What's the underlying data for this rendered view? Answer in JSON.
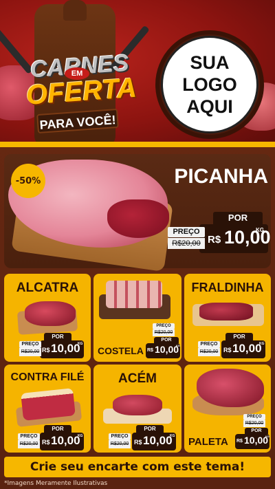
{
  "header": {
    "title_line1": "CARNES",
    "title_em": "EM",
    "title_line2": "OFERTA",
    "title_line3": "PARA VOCÊ!",
    "logo_lines": [
      "SUA",
      "LOGO",
      "AQUI"
    ]
  },
  "hero": {
    "badge": "-50%",
    "name": "PICANHA",
    "preco_label": "PREÇO",
    "old_price": "R$20,00",
    "por_label": "POR",
    "currency": "R$",
    "new_price": "10,00",
    "unit": "KG"
  },
  "products": [
    {
      "name": "ALCATRA",
      "preco_label": "PREÇO",
      "old_price": "R$20,00",
      "por_label": "POR",
      "currency": "R$",
      "new_price": "10,00",
      "unit": "KG"
    },
    {
      "name": "COSTELA",
      "preco_label": "PREÇO",
      "old_price": "R$20,00",
      "por_label": "POR",
      "currency": "R$",
      "new_price": "10,00",
      "unit": "KG"
    },
    {
      "name": "FRALDINHA",
      "preco_label": "PREÇO",
      "old_price": "R$20,00",
      "por_label": "POR",
      "currency": "R$",
      "new_price": "10,00",
      "unit": "KG"
    },
    {
      "name": "CONTRA FILÉ",
      "preco_label": "PREÇO",
      "old_price": "R$20,00",
      "por_label": "POR",
      "currency": "R$",
      "new_price": "10,00",
      "unit": "KG"
    },
    {
      "name": "ACÉM",
      "preco_label": "PREÇO",
      "old_price": "R$20,00",
      "por_label": "POR",
      "currency": "R$",
      "new_price": "10,00",
      "unit": "KG"
    },
    {
      "name": "PALETA",
      "preco_label": "PREÇO",
      "old_price": "R$20,00",
      "por_label": "POR",
      "currency": "R$",
      "new_price": "10,00",
      "unit": "KG"
    }
  ],
  "footer": {
    "cta": "Crie seu encarte com este tema!",
    "note": "*Imagens Meramente Ilustrativas"
  },
  "colors": {
    "accent_yellow": "#f5b400",
    "header_red": "#b8231c",
    "wood_brown": "#5a2a14",
    "price_dark": "#2a1207"
  }
}
